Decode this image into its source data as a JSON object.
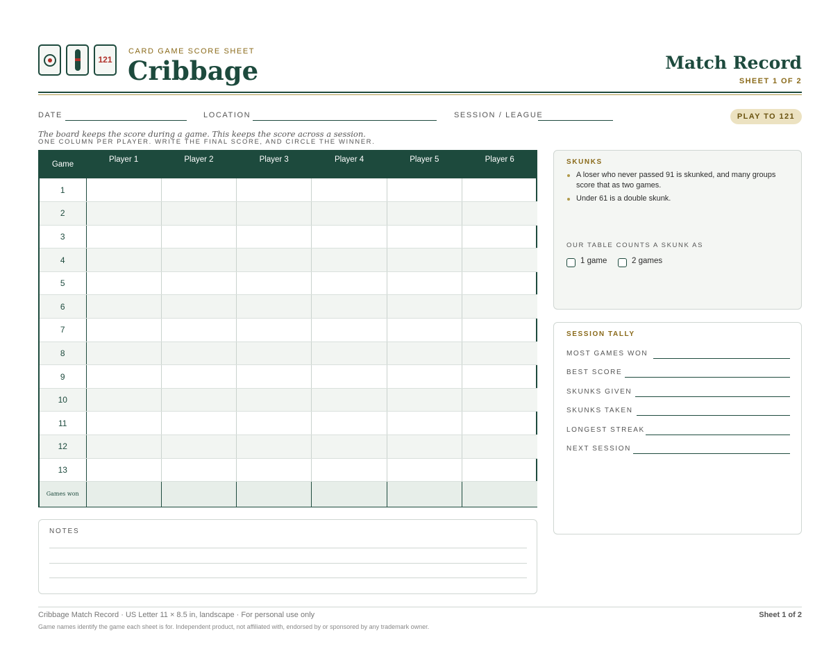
{
  "header": {
    "kicker": "CARD GAME SCORE SHEET",
    "title": "Cribbage",
    "record_title": "Match Record",
    "sheet_label": "SHEET 1 OF 2",
    "logo_card_text": "121",
    "colors": {
      "primary": "#1d4a3d",
      "accent": "#b0312a",
      "gold": "#8a6a1a"
    }
  },
  "meta": {
    "date_label": "DATE",
    "location_label": "LOCATION",
    "session_label": "SESSION / LEAGUE",
    "play_to": "PLAY TO 121"
  },
  "intro": {
    "line1": "The board keeps the score during a game. This keeps the score across a session.",
    "line2": "ONE COLUMN PER PLAYER. WRITE THE FINAL SCORE, AND CIRCLE THE WINNER."
  },
  "table": {
    "game_header": "Game",
    "players": [
      "Player 1",
      "Player 2",
      "Player 3",
      "Player 4",
      "Player 5",
      "Player 6"
    ],
    "games": [
      "1",
      "2",
      "3",
      "4",
      "5",
      "6",
      "7",
      "8",
      "9",
      "10",
      "11",
      "12",
      "13"
    ],
    "footer_label": "Games won"
  },
  "notes": {
    "label": "NOTES"
  },
  "skunks": {
    "title": "SKUNKS",
    "bullets": [
      "A loser who never passed 91 is skunked, and many groups score that as two games.",
      "Under 61 is a double skunk."
    ],
    "counts_label": "OUR TABLE COUNTS A SKUNK AS",
    "option1": "1 game",
    "option2": "2 games"
  },
  "tally": {
    "title": "SESSION TALLY",
    "rows": [
      "MOST GAMES WON",
      "BEST SCORE",
      "SKUNKS GIVEN",
      "SKUNKS TAKEN",
      "LONGEST STREAK",
      "NEXT SESSION"
    ]
  },
  "footer": {
    "left": "Cribbage Match Record   ·   US Letter 11 × 8.5 in, landscape   ·   For personal use only",
    "right": "Sheet 1 of 2",
    "disclaimer": "Game names identify the game each sheet is for. Independent product, not affiliated with, endorsed by or sponsored by any trademark owner."
  }
}
